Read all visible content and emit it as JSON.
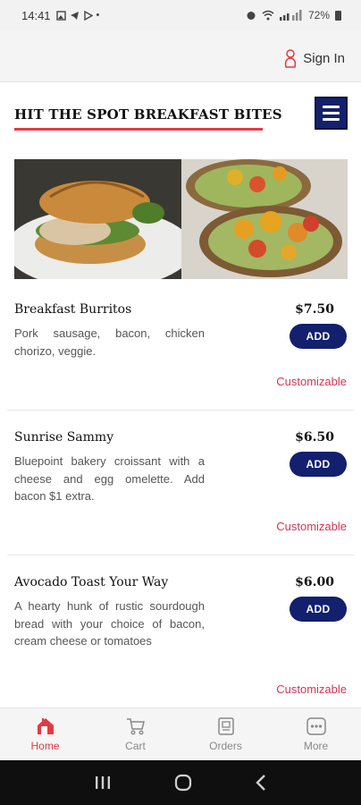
{
  "status_bar": {
    "time": "14:41",
    "battery": "72%"
  },
  "header": {
    "signin_label": "Sign In"
  },
  "shop": {
    "title": "HIT THE SPOT BREAKFAST BITES"
  },
  "menu_items": [
    {
      "name": "Breakfast Burritos",
      "price": "$7.50",
      "description": "Pork sausage, bacon, chicken chorizo, veggie.",
      "add_label": "ADD",
      "tag": "Customizable"
    },
    {
      "name": "Sunrise Sammy",
      "price": "$6.50",
      "description": "Bluepoint bakery croissant with a cheese and egg omelette. Add bacon $1 extra.",
      "add_label": "ADD",
      "tag": "Customizable"
    },
    {
      "name": "Avocado Toast Your Way",
      "price": "$6.00",
      "description": "A hearty hunk of rustic sourdough bread with your choice of bacon, cream cheese or tomatoes",
      "add_label": "ADD",
      "tag": "Customizable"
    }
  ],
  "bottom_nav": [
    {
      "label": "Home",
      "icon": "home-icon",
      "active": true
    },
    {
      "label": "Cart",
      "icon": "cart-icon",
      "active": false
    },
    {
      "label": "Orders",
      "icon": "orders-icon",
      "active": false
    },
    {
      "label": "More",
      "icon": "more-icon",
      "active": false
    }
  ],
  "colors": {
    "accent_red": "#e33a44",
    "brand_navy": "#12206e",
    "customizable_pink": "#d33556"
  }
}
